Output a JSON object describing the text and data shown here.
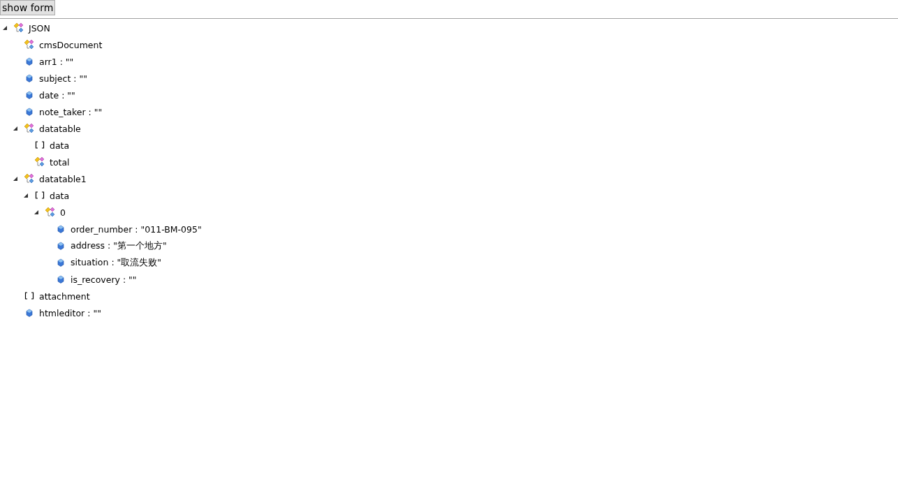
{
  "toolbar": {
    "button": "show form"
  },
  "tree": [
    {
      "label": "JSON",
      "kind": "object",
      "expanded": true,
      "children": [
        {
          "label": "cmsDocument",
          "kind": "object",
          "expanded": false
        },
        {
          "label": "arr1 : \"\"",
          "kind": "value"
        },
        {
          "label": "subject : \"\"",
          "kind": "value"
        },
        {
          "label": "date : \"\"",
          "kind": "value"
        },
        {
          "label": "note_taker : \"\"",
          "kind": "value"
        },
        {
          "label": "datatable",
          "kind": "object",
          "expanded": true,
          "children": [
            {
              "label": "data",
              "kind": "array",
              "expanded": false
            },
            {
              "label": "total",
              "kind": "object",
              "expanded": false
            }
          ]
        },
        {
          "label": "datatable1",
          "kind": "object",
          "expanded": true,
          "children": [
            {
              "label": "data",
              "kind": "array",
              "expanded": true,
              "children": [
                {
                  "label": "0",
                  "kind": "object",
                  "expanded": true,
                  "children": [
                    {
                      "label": "order_number : \"011-BM-095\"",
                      "kind": "value"
                    },
                    {
                      "label": "address : \"第一个地方\"",
                      "kind": "value"
                    },
                    {
                      "label": "situation : \"取流失败\"",
                      "kind": "value"
                    },
                    {
                      "label": "is_recovery : \"\"",
                      "kind": "value"
                    }
                  ]
                }
              ]
            }
          ]
        },
        {
          "label": "attachment",
          "kind": "array",
          "expanded": false
        },
        {
          "label": "htmleditor : \"\"",
          "kind": "value"
        }
      ]
    }
  ]
}
